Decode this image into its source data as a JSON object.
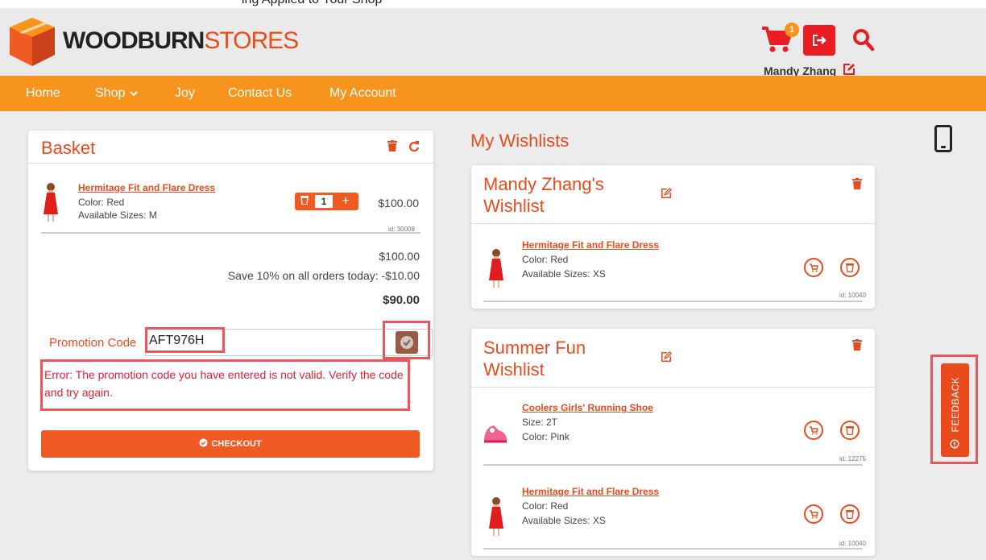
{
  "header": {
    "top_caption": "ing Applied to Your Shop",
    "brand_bold": "WOODBURN",
    "brand_light": "STORES",
    "cart_count": "1",
    "user_name": "Mandy Zhang",
    "icons": [
      "logo-box-icon",
      "cart-icon",
      "logout-icon",
      "search-icon",
      "edit-icon"
    ]
  },
  "nav": {
    "items": [
      "Home",
      "Shop",
      "Joy",
      "Contact Us",
      "My Account"
    ]
  },
  "basket": {
    "title": "Basket",
    "item": {
      "name": "Hermitage Fit and Flare Dress",
      "line1": "Color: Red",
      "line2": "Available Sizes: M",
      "qty": "1",
      "price": "$100.00",
      "id": "id: 30008"
    },
    "subtotal": "$100.00",
    "discount": "Save 10% on all orders today: -$10.00",
    "total": "$90.00",
    "promo_label": "Promotion Code",
    "promo_value": "AFT976H",
    "error": "Error: The promotion code you have entered is not valid. Verify the code and try again.",
    "checkout_label": "CHECKOUT"
  },
  "wishlists": {
    "title": "My Wishlists",
    "lists": [
      {
        "title_line1": "Mandy Zhang's",
        "title_line2": "Wishlist",
        "items": [
          {
            "name": "Hermitage Fit and Flare Dress",
            "line1": "Color: Red",
            "line2": "Available Sizes: XS",
            "id": "id: 10040"
          }
        ]
      },
      {
        "title_line1": "Summer Fun",
        "title_line2": "Wishlist",
        "items": [
          {
            "name": "Coolers Girls' Running Shoe",
            "line1": "Size: 2T",
            "line2": "Color: Pink",
            "id": "id: 12275"
          },
          {
            "name": "Hermitage Fit and Flare Dress",
            "line1": "Color: Red",
            "line2": "Available Sizes: XS",
            "id": "id: 10040"
          }
        ]
      }
    ]
  },
  "feedback": {
    "label": "FEEDBACK"
  },
  "colors": {
    "accent_orange": "#f7941d",
    "primary_orange": "#ea4b1d",
    "error_red": "#e2203a",
    "highlight_box": "#e9565c"
  }
}
